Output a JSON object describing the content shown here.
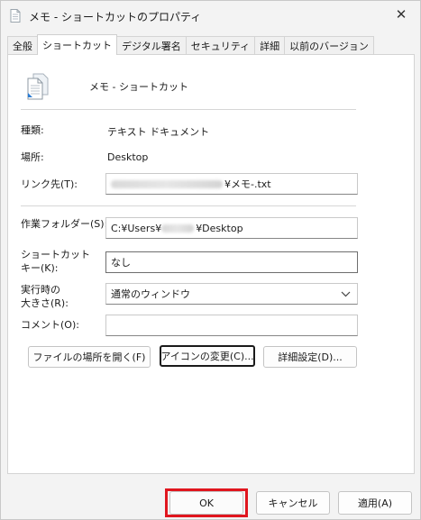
{
  "window": {
    "title": "メモ - ショートカットのプロパティ",
    "close_glyph": "✕"
  },
  "tabs": [
    {
      "label": "全般",
      "active": false
    },
    {
      "label": "ショートカット",
      "active": true
    },
    {
      "label": "デジタル署名",
      "active": false
    },
    {
      "label": "セキュリティ",
      "active": false
    },
    {
      "label": "詳細",
      "active": false
    },
    {
      "label": "以前のバージョン",
      "active": false
    }
  ],
  "header": {
    "shortcut_name": "メモ - ショートカット",
    "icon": "document-icon"
  },
  "fields": {
    "type_label": "種類:",
    "type_value": "テキスト ドキュメント",
    "location_label": "場所:",
    "location_value": "Desktop",
    "target_label": "リンク先(T):",
    "target_value_suffix": "¥メモ-.txt",
    "workdir_label": "作業フォルダー(S):",
    "workdir_prefix": "C:¥Users¥",
    "workdir_suffix": "¥Desktop",
    "hotkey_label_1": "ショートカット",
    "hotkey_label_2": "キー(K):",
    "hotkey_value": "なし",
    "run_label_1": "実行時の",
    "run_label_2": "大きさ(R):",
    "run_value": "通常のウィンドウ",
    "comment_label": "コメント(O):",
    "comment_value": ""
  },
  "buttons": {
    "open_location": "ファイルの場所を開く(F)",
    "change_icon": "アイコンの変更(C)...",
    "advanced": "詳細設定(D)...",
    "ok": "OK",
    "cancel": "キャンセル",
    "apply": "適用(A)"
  },
  "colors": {
    "highlight": "#e0161e"
  }
}
